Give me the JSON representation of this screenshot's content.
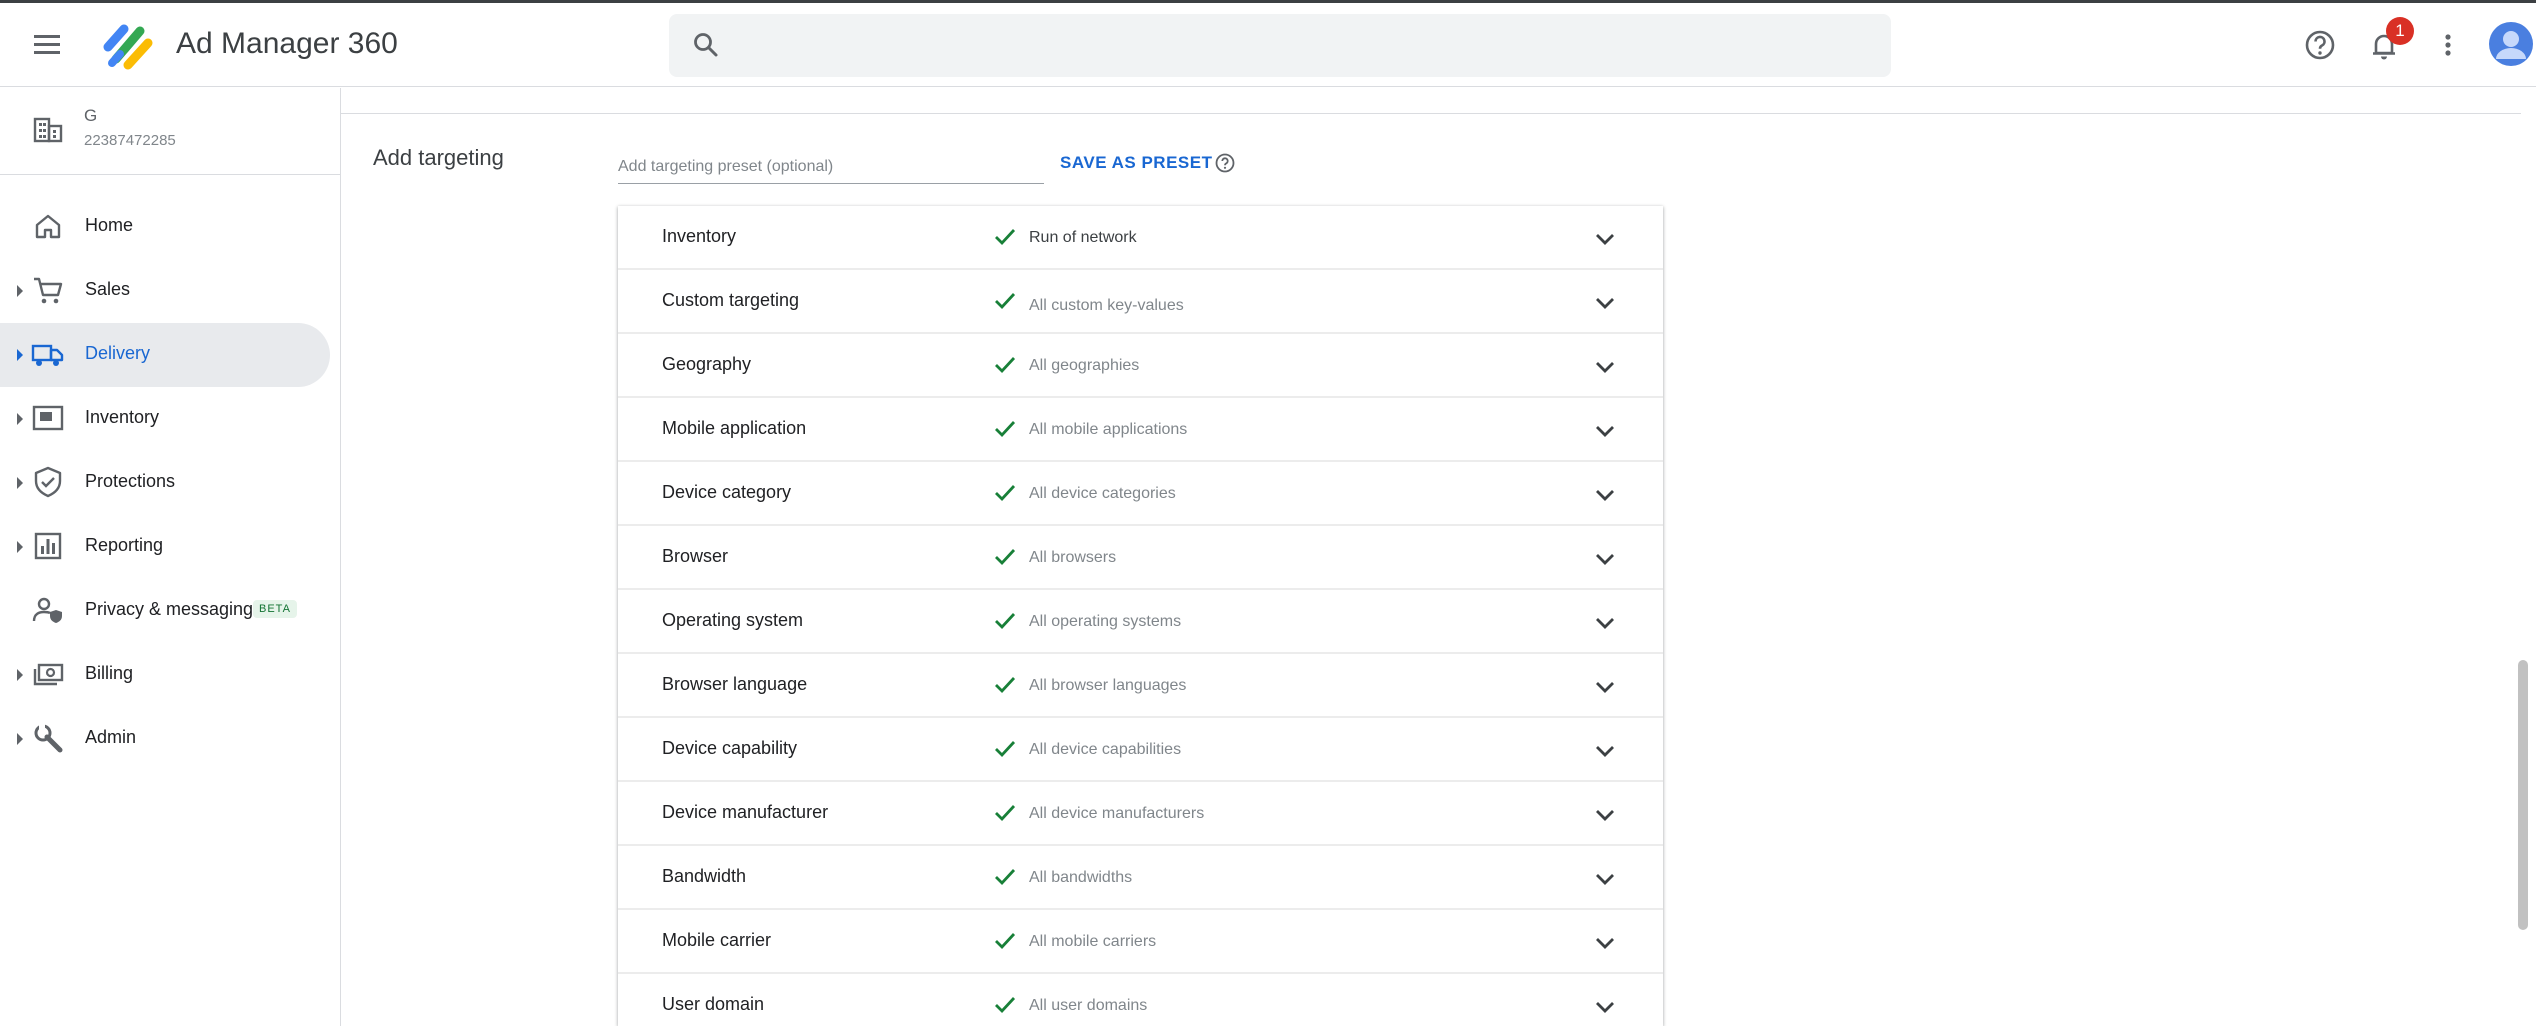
{
  "header": {
    "app_title": "Ad Manager 360",
    "notification_count": "1"
  },
  "sidebar": {
    "account_name": "G",
    "account_id": "22387472285",
    "items": [
      {
        "label": "Home",
        "icon": "home-icon",
        "expandable": false
      },
      {
        "label": "Sales",
        "icon": "cart-icon",
        "expandable": true
      },
      {
        "label": "Delivery",
        "icon": "truck-icon",
        "expandable": true,
        "active": true
      },
      {
        "label": "Inventory",
        "icon": "inventory-icon",
        "expandable": true
      },
      {
        "label": "Protections",
        "icon": "shield-icon",
        "expandable": true
      },
      {
        "label": "Reporting",
        "icon": "bar-chart-icon",
        "expandable": true
      },
      {
        "label": "Privacy & messaging",
        "icon": "privacy-icon",
        "expandable": false,
        "badge": "BETA"
      },
      {
        "label": "Billing",
        "icon": "billing-icon",
        "expandable": true
      },
      {
        "label": "Admin",
        "icon": "wrench-icon",
        "expandable": true
      }
    ]
  },
  "targeting": {
    "title": "Add targeting",
    "preset_placeholder": "Add targeting preset (optional)",
    "save_preset_label": "SAVE AS PRESET",
    "rows": [
      {
        "name": "Inventory",
        "value": "Run of network"
      },
      {
        "name": "Custom targeting",
        "value": "All custom key-values"
      },
      {
        "name": "Geography",
        "value": "All geographies"
      },
      {
        "name": "Mobile application",
        "value": "All mobile applications"
      },
      {
        "name": "Device category",
        "value": "All device categories"
      },
      {
        "name": "Browser",
        "value": "All browsers"
      },
      {
        "name": "Operating system",
        "value": "All operating systems"
      },
      {
        "name": "Browser language",
        "value": "All browser languages"
      },
      {
        "name": "Device capability",
        "value": "All device capabilities"
      },
      {
        "name": "Device manufacturer",
        "value": "All device manufacturers"
      },
      {
        "name": "Bandwidth",
        "value": "All bandwidths"
      },
      {
        "name": "Mobile carrier",
        "value": "All mobile carriers"
      },
      {
        "name": "User domain",
        "value": "All user domains"
      }
    ]
  },
  "colors": {
    "accent": "#1967d2",
    "check": "#188038",
    "badge": "#d93025"
  }
}
